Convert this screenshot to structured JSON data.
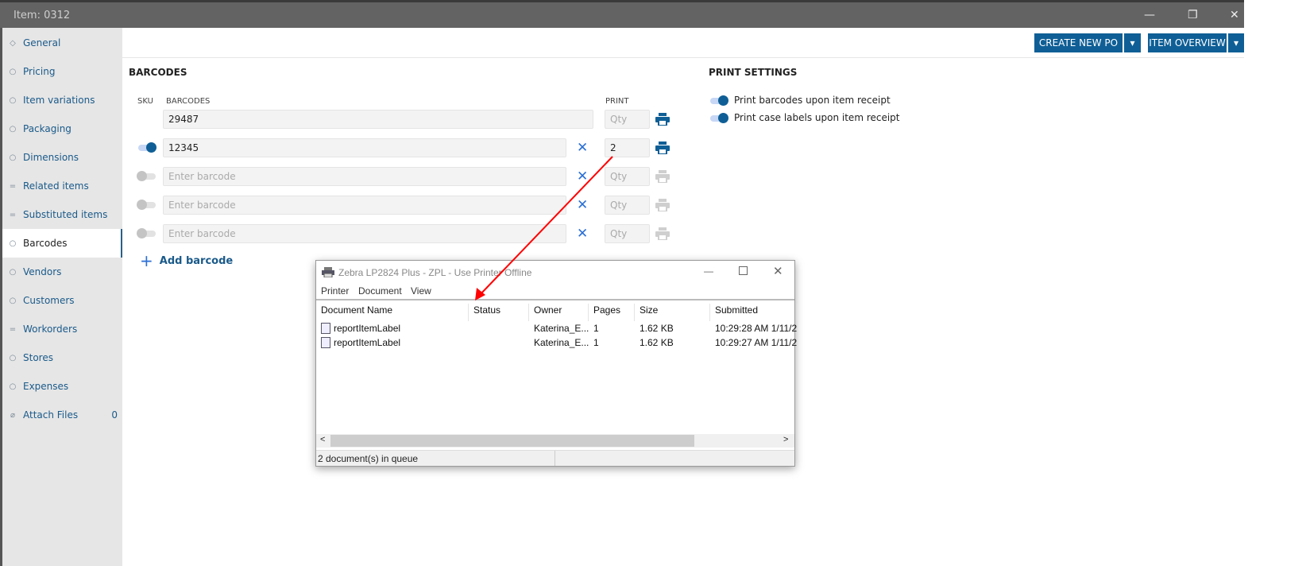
{
  "window": {
    "title": "Item: 0312",
    "minimize": "—",
    "restore": "❐",
    "close": "✕"
  },
  "sidebar": {
    "items": [
      {
        "label": "General",
        "icon": "diamond-icon"
      },
      {
        "label": "Pricing",
        "icon": "circle-icon"
      },
      {
        "label": "Item variations",
        "icon": "circle-icon"
      },
      {
        "label": "Packaging",
        "icon": "circle-icon"
      },
      {
        "label": "Dimensions",
        "icon": "circle-icon"
      },
      {
        "label": "Related items",
        "icon": "lines-icon"
      },
      {
        "label": "Substituted items",
        "icon": "lines-icon"
      },
      {
        "label": "Barcodes",
        "icon": "circle-icon",
        "active": true
      },
      {
        "label": "Vendors",
        "icon": "circle-icon"
      },
      {
        "label": "Customers",
        "icon": "circle-icon"
      },
      {
        "label": "Workorders",
        "icon": "lines-icon"
      },
      {
        "label": "Stores",
        "icon": "circle-icon"
      },
      {
        "label": "Expenses",
        "icon": "circle-icon"
      },
      {
        "label": "Attach Files",
        "icon": "paperclip-icon",
        "count": "0"
      }
    ]
  },
  "toolbar": {
    "create_po": "CREATE NEW PO",
    "item_overview": "ITEM OVERVIEW",
    "dropdown": "▾"
  },
  "barcodes": {
    "title": "BARCODES",
    "col_sku": "SKU",
    "col_barcodes": "BARCODES",
    "col_print": "PRINT",
    "rows": [
      {
        "value": "29487",
        "placeholder": "Enter barcode",
        "qty": "",
        "qty_placeholder": "Qty",
        "sku_toggle": null,
        "removable": false,
        "print_enabled": true
      },
      {
        "value": "12345",
        "placeholder": "Enter barcode",
        "qty": "2",
        "qty_placeholder": "Qty",
        "sku_toggle": true,
        "removable": true,
        "print_enabled": true
      },
      {
        "value": "",
        "placeholder": "Enter barcode",
        "qty": "",
        "qty_placeholder": "Qty",
        "sku_toggle": false,
        "removable": true,
        "print_enabled": false
      },
      {
        "value": "",
        "placeholder": "Enter barcode",
        "qty": "",
        "qty_placeholder": "Qty",
        "sku_toggle": false,
        "removable": true,
        "print_enabled": false
      },
      {
        "value": "",
        "placeholder": "Enter barcode",
        "qty": "",
        "qty_placeholder": "Qty",
        "sku_toggle": false,
        "removable": true,
        "print_enabled": false
      }
    ],
    "add_label": "Add barcode",
    "remove_glyph": "✕",
    "add_glyph": "+"
  },
  "print_settings": {
    "title": "PRINT SETTINGS",
    "options": [
      {
        "label": "Print barcodes upon item receipt",
        "on": true
      },
      {
        "label": "Print case labels upon item receipt",
        "on": true
      }
    ]
  },
  "printer_dialog": {
    "title": "Zebra LP2824 Plus - ZPL  -  Use Printer Offline",
    "menu": [
      "Printer",
      "Document",
      "View"
    ],
    "columns": [
      "Document Name",
      "Status",
      "Owner",
      "Pages",
      "Size",
      "Submitted"
    ],
    "rows": [
      [
        "reportItemLabel",
        "",
        "Katerina_E...",
        "1",
        "1.62 KB",
        "10:29:28 AM  1/11/2"
      ],
      [
        "reportItemLabel",
        "",
        "Katerina_E...",
        "1",
        "1.62 KB",
        "10:29:27 AM  1/11/2"
      ]
    ],
    "status": "2 document(s) in queue",
    "scroll_left": "<",
    "scroll_right": ">"
  },
  "colors": {
    "accent": "#0f5f96",
    "link": "#1a5a8a",
    "remove": "#2b6fd6",
    "annotation_arrow": "#ff0000"
  }
}
